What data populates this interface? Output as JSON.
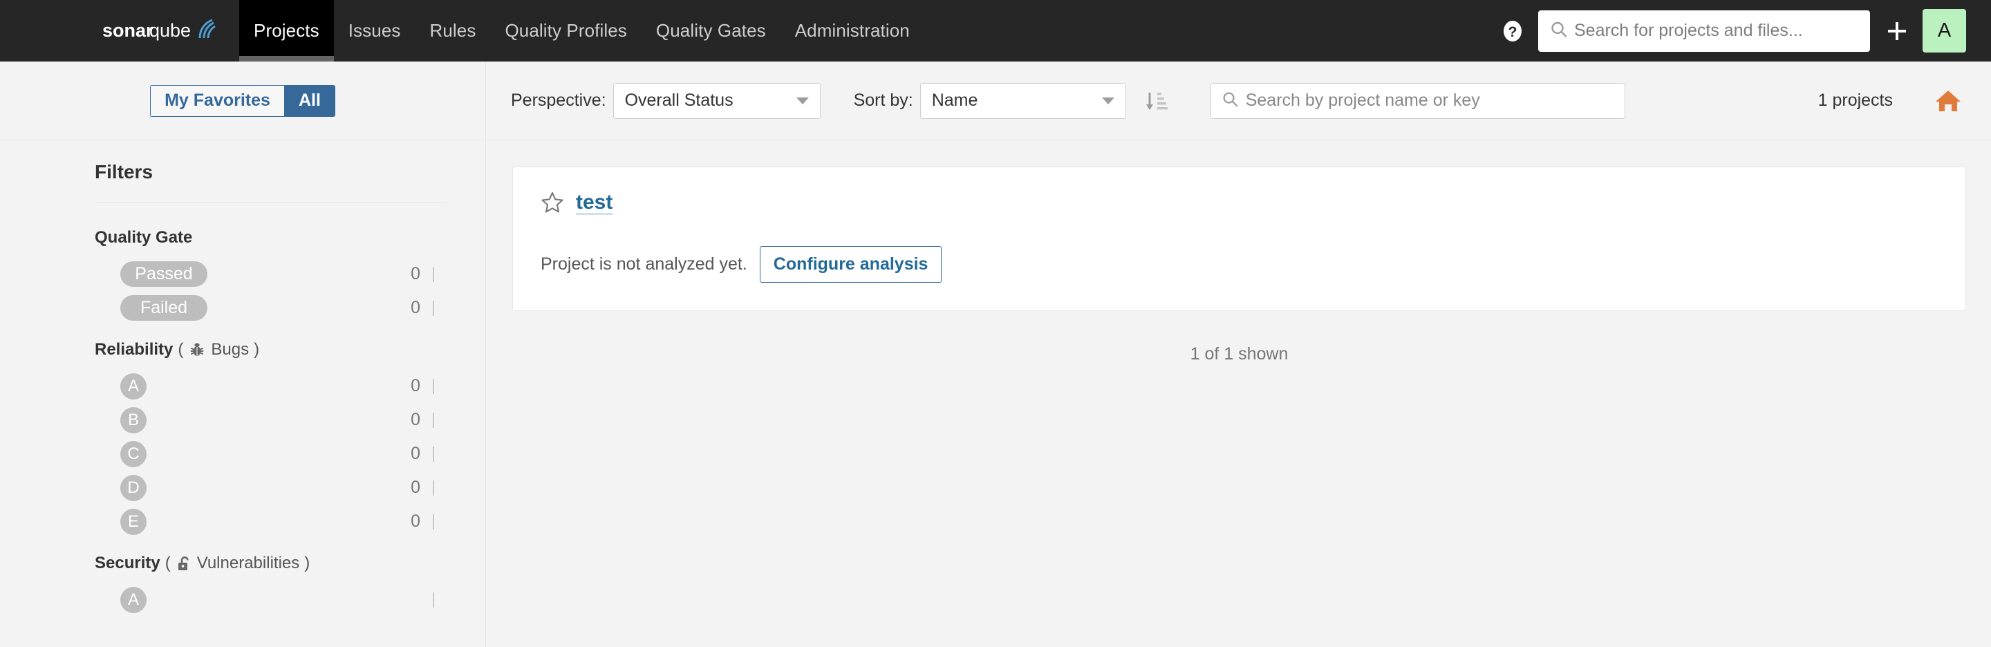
{
  "navbar": {
    "brand": "sonarqube",
    "brand_icon": "sonarqube-logo-icon",
    "tabs": [
      {
        "label": "Projects",
        "active": true
      },
      {
        "label": "Issues",
        "active": false
      },
      {
        "label": "Rules",
        "active": false
      },
      {
        "label": "Quality Profiles",
        "active": false
      },
      {
        "label": "Quality Gates",
        "active": false
      },
      {
        "label": "Administration",
        "active": false
      }
    ],
    "help_icon": "help-circle-icon",
    "search": {
      "icon": "search-icon",
      "placeholder": "Search for projects and files...",
      "value": ""
    },
    "plus_icon": "plus-icon",
    "avatar": {
      "initial": "A",
      "background": "#bbf0bf"
    }
  },
  "sidebar": {
    "favorites_toggle": {
      "my_favorites_label": "My Favorites",
      "all_label": "All",
      "selected": "All"
    },
    "filters_title": "Filters",
    "facets": [
      {
        "name": "Quality Gate",
        "metric": "",
        "icon": "",
        "rows": [
          {
            "kind": "pill",
            "label": "Passed",
            "count": "0"
          },
          {
            "kind": "pill",
            "label": "Failed",
            "count": "0"
          }
        ]
      },
      {
        "name": "Reliability",
        "metric": "Bugs",
        "icon": "bug-icon",
        "rows": [
          {
            "kind": "rating",
            "label": "A",
            "count": "0"
          },
          {
            "kind": "rating",
            "label": "B",
            "count": "0"
          },
          {
            "kind": "rating",
            "label": "C",
            "count": "0"
          },
          {
            "kind": "rating",
            "label": "D",
            "count": "0"
          },
          {
            "kind": "rating",
            "label": "E",
            "count": "0"
          }
        ]
      },
      {
        "name": "Security",
        "metric": "Vulnerabilities",
        "icon": "open-lock-icon",
        "rows": [
          {
            "kind": "rating",
            "label": "A",
            "count": ""
          }
        ]
      }
    ],
    "paren_open": "(",
    "paren_close": ")"
  },
  "toolbar": {
    "perspective_label": "Perspective:",
    "perspective_value": "Overall Status",
    "sortby_label": "Sort by:",
    "sortby_value": "Name",
    "sort_direction_icon": "sort-ascending-icon",
    "search": {
      "icon": "search-icon",
      "placeholder": "Search by project name or key",
      "value": ""
    },
    "projects_count": "1 projects",
    "home_icon": "home-icon"
  },
  "main": {
    "project": {
      "favorite_icon": "star-outline-icon",
      "name": "test",
      "status_text": "Project is not analyzed yet.",
      "configure_button": "Configure analysis"
    },
    "shown_note": "1 of 1 shown"
  },
  "colors": {
    "navbar_bg": "#262626",
    "active_tab_bg": "#000000",
    "accent_blue": "#36699a",
    "link_blue": "#236a97",
    "home_orange": "#e07b39",
    "facet_gray": "#bdbdbd",
    "page_bg": "#f3f3f3"
  }
}
